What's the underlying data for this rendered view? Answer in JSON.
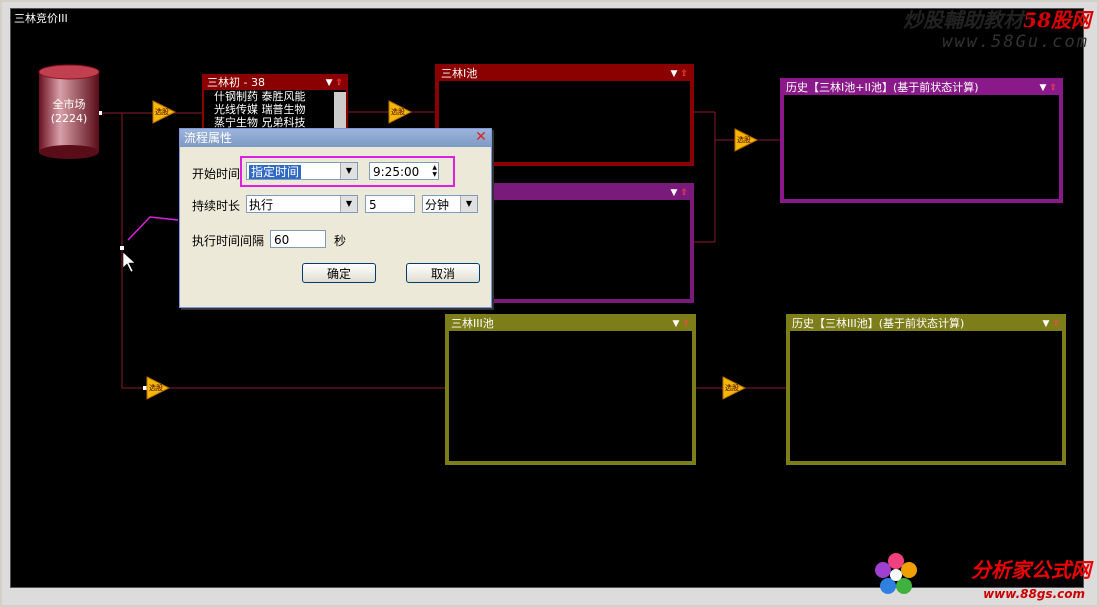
{
  "window_title": "三林竞价III",
  "watermark_top": {
    "part1": "炒股輔助教材",
    "part2": "58股网",
    "url": "www.58Gu.com"
  },
  "watermark_bottom": {
    "name": "分析家公式网",
    "url": "www.88gs.com"
  },
  "market_node": {
    "line1": "全市场",
    "line2": "(2224)"
  },
  "filter_label": "选股",
  "stock_list": {
    "title": "三林初 - 38",
    "rows": [
      "什钢制药  泰胜风能",
      "光线传媒  瑞普生物",
      "蒸宁生物  兄弟科技"
    ]
  },
  "pools": {
    "pool1": {
      "title": "三林I池"
    },
    "pool2": {
      "title": ""
    },
    "pool3": {
      "title": "三林III池"
    },
    "hist12": {
      "title": "历史【三林I池+II池】(基于前状态计算)"
    },
    "hist3": {
      "title": "历史【三林III池】(基于前状态计算)"
    }
  },
  "dialog": {
    "title": "流程属性",
    "start_label": "开始时间",
    "start_mode": "指定时间",
    "start_time": "9:25:00",
    "duration_label": "持续时长",
    "duration_mode": "执行",
    "duration_value": "5",
    "duration_unit": "分钟",
    "interval_label": "执行时间间隔",
    "interval_value": "60",
    "interval_unit": "秒",
    "ok_label": "确定",
    "cancel_label": "取消"
  },
  "colors": {
    "pool1": "#8b0000",
    "pool2": "#7a1a7a",
    "pool3": "#7d7d1a",
    "hist12": "#8a1a8a",
    "hist3": "#7d7d1a",
    "annotation": "#e020e0"
  }
}
